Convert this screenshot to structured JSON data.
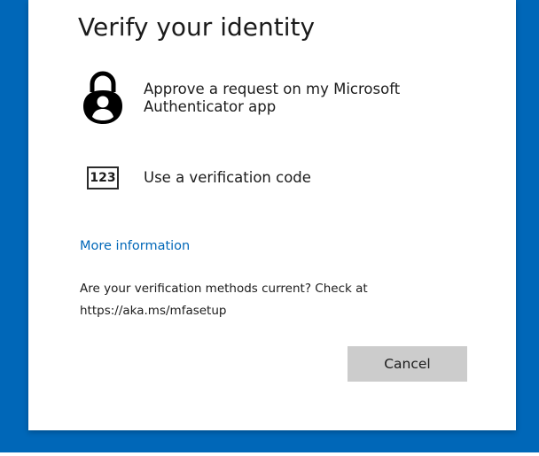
{
  "dialog": {
    "title": "Verify your identity",
    "options": [
      {
        "icon": "authenticator-lock-icon",
        "label": "Approve a request on my Microsoft Authenticator app"
      },
      {
        "icon": "verification-code-icon",
        "icon_text": "123",
        "label": "Use a verification code"
      }
    ],
    "more_info_link": "More information",
    "notice_line1": "Are your verification methods current? Check at",
    "notice_line2": "https://aka.ms/mfasetup",
    "cancel_label": "Cancel"
  },
  "colors": {
    "background": "#0067b8",
    "link": "#0067b8",
    "button": "#cccccc",
    "text": "#1b1b1b"
  }
}
